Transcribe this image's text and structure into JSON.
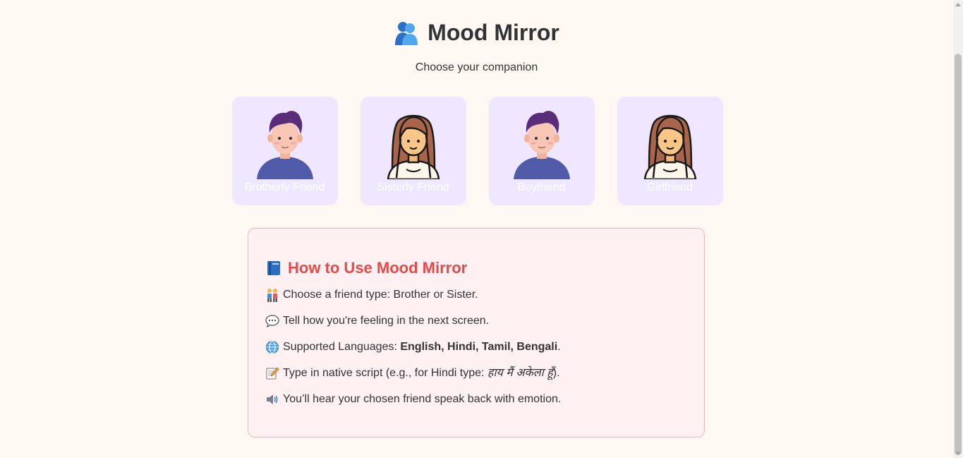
{
  "header": {
    "title": "Mood Mirror",
    "title_icon": "people-hugging-icon",
    "subtitle": "Choose your companion"
  },
  "cards": [
    {
      "label": "Brotherly Friend",
      "avatar": "male-avatar"
    },
    {
      "label": "Sisterly Friend",
      "avatar": "female-avatar"
    },
    {
      "label": "Boyfriend",
      "avatar": "male-avatar"
    },
    {
      "label": "Girlfriend",
      "avatar": "female-avatar"
    }
  ],
  "info": {
    "title": "How to Use Mood Mirror",
    "title_icon": "blue-book-icon",
    "items": [
      {
        "icon": "two-people-icon",
        "text": "Choose a friend type: Brother or Sister."
      },
      {
        "icon": "speech-bubble-icon",
        "text": "Tell how you're feeling in the next screen."
      },
      {
        "icon": "globe-icon",
        "prefix": "Supported Languages: ",
        "bold": "English, Hindi, Tamil, Bengali",
        "suffix": "."
      },
      {
        "icon": "memo-icon",
        "prefix": "Type in native script (e.g., for Hindi type: ",
        "italic": "हाय मैं अकेला हूँ",
        "suffix": ")."
      },
      {
        "icon": "speaker-icon",
        "text": "You’ll hear your chosen friend speak back with emotion."
      }
    ]
  },
  "colors": {
    "background": "#fff8f2",
    "card_bg": "#efe6ff",
    "info_bg": "#fff0f2",
    "info_border": "#f3b6c0",
    "accent_red": "#e94848",
    "shirt_blue": "#4f5aa8",
    "hair_purple": "#5a2d7a"
  }
}
